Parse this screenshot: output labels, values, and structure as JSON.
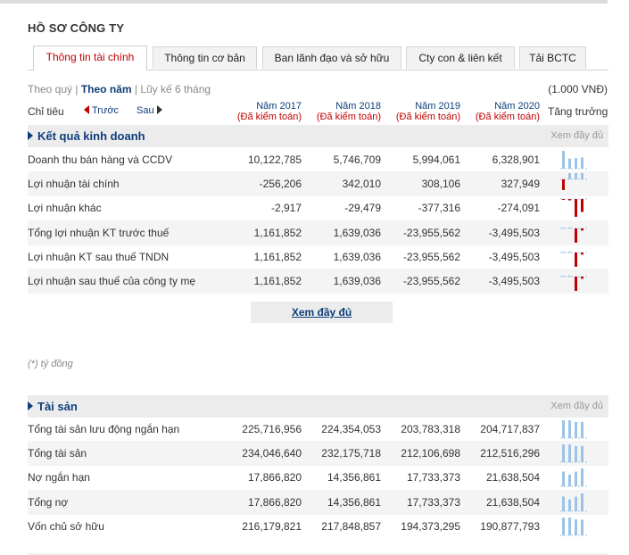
{
  "heading": "HỒ SƠ CÔNG TY",
  "tabs": [
    {
      "label": "Thông tin tài chính"
    },
    {
      "label": "Thông tin cơ bản"
    },
    {
      "label": "Ban lãnh đạo và sở hữu"
    },
    {
      "label": "Cty con & liên kết"
    },
    {
      "label": "Tải BCTC"
    }
  ],
  "filters": {
    "quarter": "Theo quý",
    "sep1": " | ",
    "year": "Theo năm",
    "sep2": " | ",
    "cumulative": "Lũy kế 6 tháng"
  },
  "unit": "(1.000 VNĐ)",
  "chitieu": "Chỉ tiêu",
  "nav": {
    "prev": "Trước",
    "next": "Sau"
  },
  "growth_label": "Tăng trưởng",
  "columns": [
    {
      "year": "Năm 2017",
      "audit": "(Đã kiểm toán)"
    },
    {
      "year": "Năm 2018",
      "audit": "(Đã kiểm toán)"
    },
    {
      "year": "Năm 2019",
      "audit": "(Đã kiểm toán)"
    },
    {
      "year": "Năm 2020",
      "audit": "(Đã kiểm toán)"
    }
  ],
  "section1": {
    "title": "Kết quả kinh doanh",
    "more": "Xem đầy đủ",
    "rows": [
      {
        "label": "Doanh thu bán hàng và CCDV",
        "values": [
          "10,122,785",
          "5,746,709",
          "5,994,061",
          "6,328,901"
        ],
        "nums": [
          10122785,
          5746709,
          5994061,
          6328901
        ]
      },
      {
        "label": "Lợi nhuận tài chính",
        "values": [
          "-256,206",
          "342,010",
          "308,106",
          "327,949"
        ],
        "nums": [
          -256206,
          342010,
          308106,
          327949
        ]
      },
      {
        "label": "Lợi nhuận khác",
        "values": [
          "-2,917",
          "-29,479",
          "-377,316",
          "-274,091"
        ],
        "nums": [
          -2917,
          -29479,
          -377316,
          -274091
        ]
      },
      {
        "label": "Tổng lợi nhuận KT trước thuế",
        "values": [
          "1,161,852",
          "1,639,036",
          "-23,955,562",
          "-3,495,503"
        ],
        "nums": [
          1161852,
          1639036,
          -23955562,
          -3495503
        ]
      },
      {
        "label": "Lợi nhuận KT sau thuế TNDN",
        "values": [
          "1,161,852",
          "1,639,036",
          "-23,955,562",
          "-3,495,503"
        ],
        "nums": [
          1161852,
          1639036,
          -23955562,
          -3495503
        ]
      },
      {
        "label": "Lợi nhuận sau thuế của công ty mẹ",
        "values": [
          "1,161,852",
          "1,639,036",
          "-23,955,562",
          "-3,495,503"
        ],
        "nums": [
          1161852,
          1639036,
          -23955562,
          -3495503
        ]
      }
    ]
  },
  "more_button": "Xem đầy đủ",
  "note": "(*) tỷ đồng",
  "section2": {
    "title": "Tài sản",
    "more": "Xem đầy đủ",
    "rows": [
      {
        "label": "Tổng tài sản lưu động ngắn hạn",
        "values": [
          "225,716,956",
          "224,354,053",
          "203,783,318",
          "204,717,837"
        ],
        "nums": [
          225716956,
          224354053,
          203783318,
          204717837
        ]
      },
      {
        "label": "Tổng tài sản",
        "values": [
          "234,046,640",
          "232,175,718",
          "212,106,698",
          "212,516,296"
        ],
        "nums": [
          234046640,
          232175718,
          212106698,
          212516296
        ]
      },
      {
        "label": "Nợ ngắn hạn",
        "values": [
          "17,866,820",
          "14,356,861",
          "17,733,373",
          "21,638,504"
        ],
        "nums": [
          17866820,
          14356861,
          17733373,
          21638504
        ]
      },
      {
        "label": "Tổng nợ",
        "values": [
          "17,866,820",
          "14,356,861",
          "17,733,373",
          "21,638,504"
        ],
        "nums": [
          17866820,
          14356861,
          17733373,
          21638504
        ]
      },
      {
        "label": "Vốn chủ sở hữu",
        "values": [
          "216,179,821",
          "217,848,857",
          "194,373,295",
          "190,877,793"
        ],
        "nums": [
          216179821,
          217848857,
          194373295,
          190877793
        ]
      }
    ]
  },
  "colors": {
    "positive": "#9cc3e6",
    "negative": "#c00000",
    "accent": "#0d3d7a",
    "tab_active": "#c00000"
  }
}
